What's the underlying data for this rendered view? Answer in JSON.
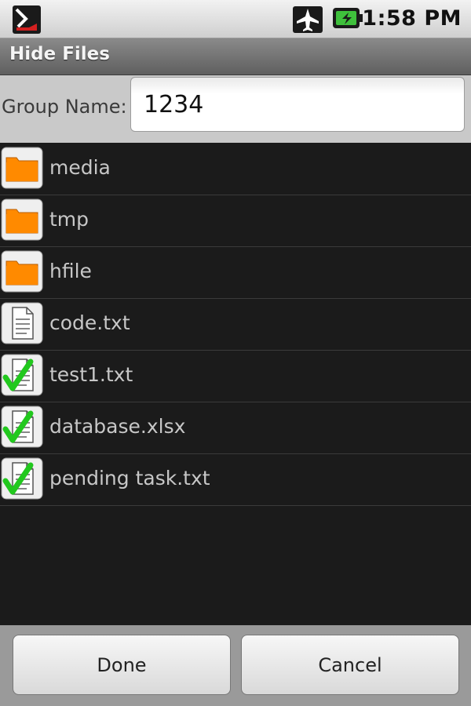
{
  "status_bar": {
    "time": "1:58 PM",
    "icons": [
      "app-notification-icon",
      "airplane-mode-icon",
      "battery-charging-icon"
    ]
  },
  "title_bar": {
    "title": "Hide Files"
  },
  "group": {
    "label": "Group Name:",
    "value": "1234"
  },
  "files": [
    {
      "name": "media",
      "type": "folder",
      "checked": false
    },
    {
      "name": "tmp",
      "type": "folder",
      "checked": false
    },
    {
      "name": "hfile",
      "type": "folder",
      "checked": false
    },
    {
      "name": "code.txt",
      "type": "file",
      "checked": false
    },
    {
      "name": "test1.txt",
      "type": "file",
      "checked": true
    },
    {
      "name": "database.xlsx",
      "type": "file",
      "checked": true
    },
    {
      "name": "pending task.txt",
      "type": "file",
      "checked": true
    }
  ],
  "buttons": {
    "done": "Done",
    "cancel": "Cancel"
  },
  "colors": {
    "folder": "#ff8a00",
    "checkmark": "#22c81e",
    "list_background": "#1b1b1b"
  }
}
